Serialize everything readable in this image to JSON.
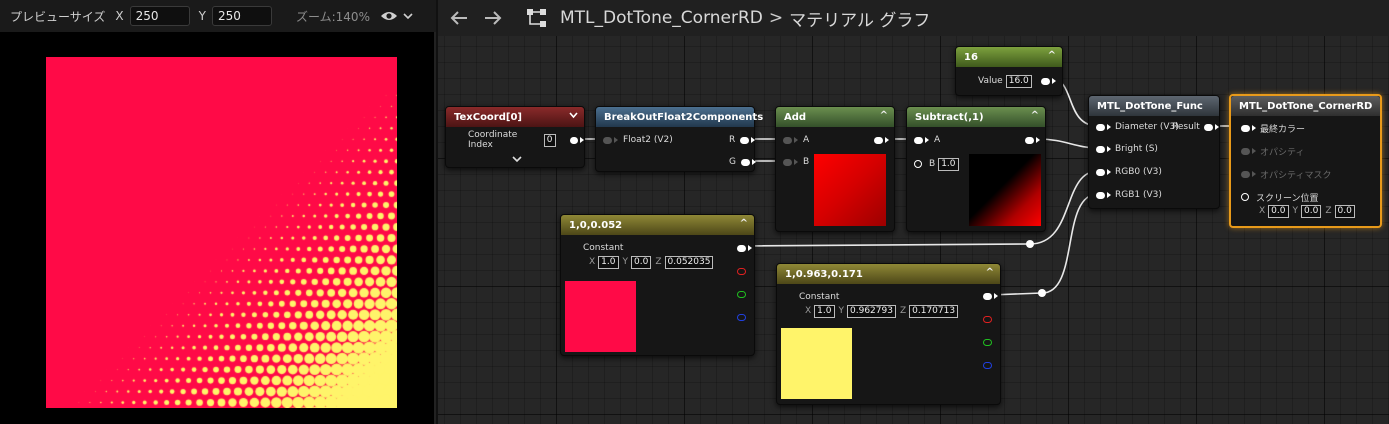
{
  "preview": {
    "size_label": "プレビューサイズ",
    "x_label": "X",
    "x_value": "250",
    "y_label": "Y",
    "y_value": "250",
    "zoom_label": "ズーム:140%",
    "eye_icon": "eye-icon",
    "chevron_icon": "chevron-down-icon",
    "color_base": "#FF0A47",
    "color_dot": "#FFF46A"
  },
  "toolbar": {
    "back_icon": "arrow-left-icon",
    "forward_icon": "arrow-right-icon",
    "graph_icon": "graph-icon",
    "asset_name": "MTL_DotTone_CornerRD",
    "separator": ">",
    "graph_name": "マテリアル グラフ"
  },
  "nodes": {
    "texcoord": {
      "title": "TexCoord[0]",
      "pin_label": "Coordinate Index",
      "value": "0",
      "expand": "⌄"
    },
    "breakout": {
      "title": "BreakOutFloat2Components",
      "input_label": "Float2 (V2)",
      "out_r": "R",
      "out_g": "G"
    },
    "add": {
      "title": "Add",
      "in_a": "A",
      "in_b": "B",
      "collapse": "^"
    },
    "subtract": {
      "title": "Subtract(,1)",
      "in_a": "A",
      "in_b": "B",
      "b_value": "1.0",
      "collapse": "^"
    },
    "scalar16": {
      "title": "16",
      "label": "Value",
      "value": "16.0",
      "collapse": "^"
    },
    "dottone": {
      "title": "MTL_DotTone_Func",
      "in_diameter": "Diameter (V3)",
      "out_result": "Result",
      "in_bright": "Bright (S)",
      "in_rgb0": "RGB0 (V3)",
      "in_rgb1": "RGB1 (V3)"
    },
    "result": {
      "title": "MTL_DotTone_CornerRD",
      "final_color": "最終カラー",
      "opacity": "オパシティ",
      "opacity_mask": "オパシティマスク",
      "screen_pos": "スクリーン位置",
      "x": "X",
      "x_value": "0.0",
      "y": "Y",
      "y_value": "0.0",
      "z": "Z",
      "z_value": "0.0"
    },
    "const1": {
      "title": "1,0,0.052",
      "label": "Constant",
      "x": "X",
      "x_value": "1.0",
      "y": "Y",
      "y_value": "0.0",
      "z": "Z",
      "z_value": "0.052035",
      "collapse": "^",
      "swatch": "#FF0A47"
    },
    "const2": {
      "title": "1,0.963,0.171",
      "label": "Constant",
      "x": "X",
      "x_value": "1.0",
      "y": "Y",
      "y_value": "0.962793",
      "z": "Z",
      "z_value": "0.170713",
      "collapse": "^",
      "swatch": "#FFF46A"
    }
  }
}
